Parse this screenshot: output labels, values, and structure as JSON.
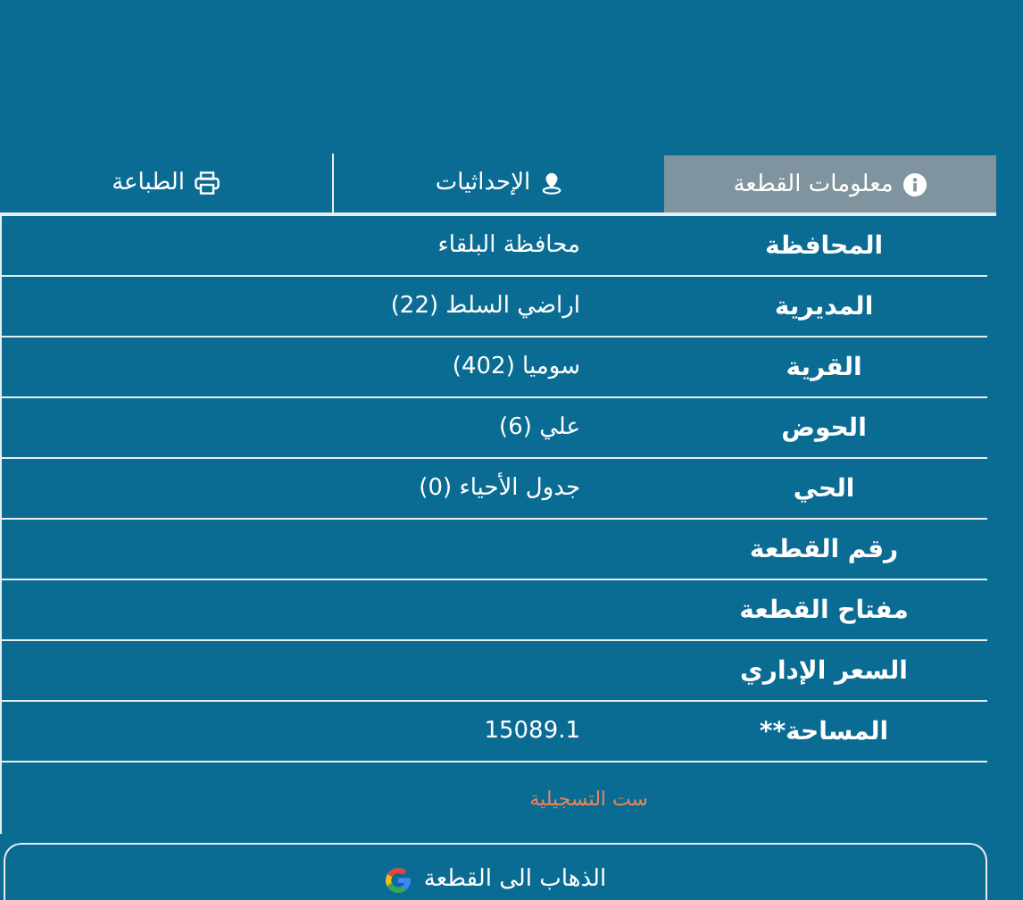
{
  "tabs": [
    {
      "label": "معلومات القطعة",
      "kind": "info",
      "selected": true
    },
    {
      "label": "الإحداثيات",
      "kind": "location",
      "selected": false
    },
    {
      "label": "الطباعة",
      "kind": "print",
      "selected": false
    }
  ],
  "rows": [
    {
      "label": "المحافظة",
      "value": "محافظة البلقاء"
    },
    {
      "label": "المديرية",
      "value": "اراضي السلط (22)"
    },
    {
      "label": "القرية",
      "value": "سوميا (402)"
    },
    {
      "label": "الحوض",
      "value": "علي (6)"
    },
    {
      "label": "الحي",
      "value": "جدول الأحياء (0)"
    },
    {
      "label": "رقم القطعة"
    },
    {
      "label": "مفتاح القطعة"
    },
    {
      "label": "السعر الإداري"
    },
    {
      "label": "المساحة**",
      "value": "15089.1"
    }
  ],
  "note": "ست التسجيلية",
  "go_button": {
    "label": "الذهاب الى القطعة"
  }
}
